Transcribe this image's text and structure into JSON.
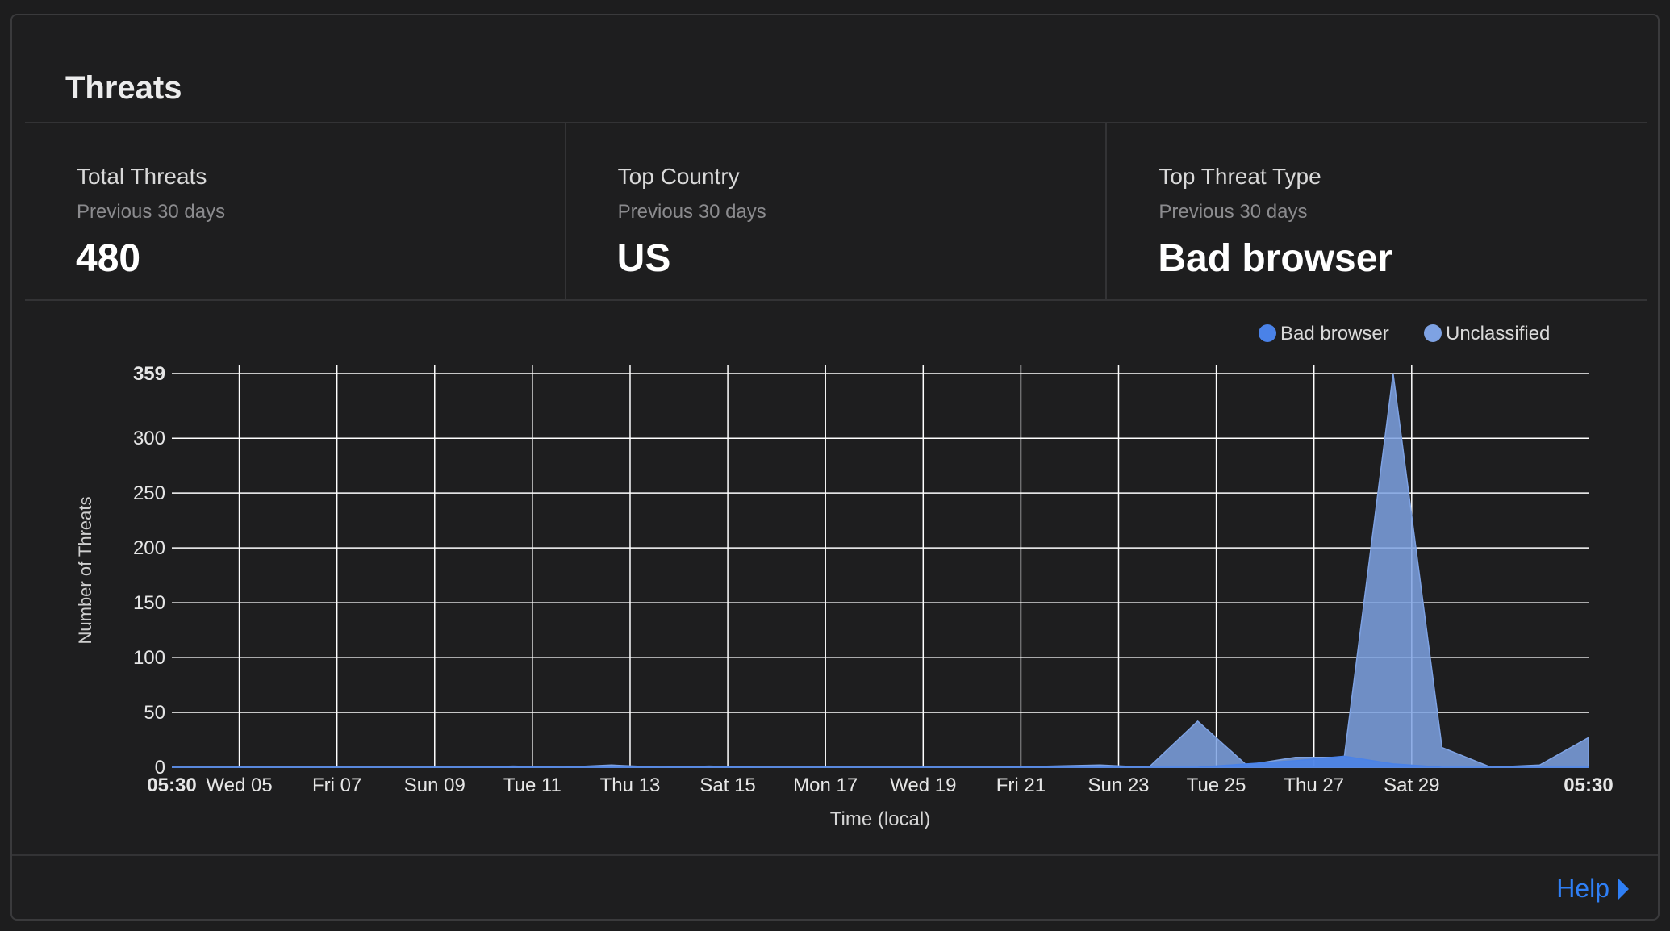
{
  "card": {
    "title": "Threats"
  },
  "stats": [
    {
      "label": "Total Threats",
      "sub": "Previous 30 days",
      "value": "480"
    },
    {
      "label": "Top Country",
      "sub": "Previous 30 days",
      "value": "US"
    },
    {
      "label": "Top Threat Type",
      "sub": "Previous 30 days",
      "value": "Bad browser"
    }
  ],
  "footer": {
    "help_label": "Help"
  },
  "chart_data": {
    "type": "area",
    "title": "",
    "xlabel": "Time (local)",
    "ylabel": "Number of Threats",
    "ylim": [
      0,
      359
    ],
    "yticks": [
      0,
      50,
      100,
      150,
      200,
      250,
      300,
      359
    ],
    "grid": true,
    "legend_position": "top-right",
    "x_tick_labels": [
      "05:30",
      "Wed 05",
      "Fri 07",
      "Sun 09",
      "Tue 11",
      "Thu 13",
      "Sat 15",
      "Mon 17",
      "Wed 19",
      "Fri 21",
      "Sun 23",
      "Tue 25",
      "Thu 27",
      "Sat 29",
      "05:30"
    ],
    "x_tick_days": [
      0,
      1.38,
      3.38,
      5.38,
      7.38,
      9.38,
      11.38,
      13.38,
      15.38,
      17.38,
      19.38,
      21.38,
      23.38,
      25.38,
      29
    ],
    "x_days": [
      0,
      1,
      2,
      3,
      4,
      5,
      6,
      7,
      8,
      9,
      10,
      11,
      12,
      13,
      14,
      15,
      16,
      17,
      18,
      19,
      20,
      21,
      22,
      23,
      24,
      25,
      26,
      27,
      28,
      29
    ],
    "series": [
      {
        "name": "Bad browser",
        "color": "#4a82e8",
        "values": [
          0,
          0,
          0,
          0,
          0,
          0,
          0,
          0,
          0,
          0,
          0,
          0,
          0,
          0,
          0,
          0,
          0,
          0,
          0,
          0,
          0,
          0,
          3,
          6,
          10,
          3,
          0,
          0,
          0,
          0
        ]
      },
      {
        "name": "Unclassified",
        "color": "#7ea2e3",
        "values": [
          0,
          0,
          0,
          0,
          0,
          0,
          0,
          1,
          0,
          2,
          0,
          1,
          0,
          0,
          0,
          0,
          0,
          0,
          1,
          2,
          0,
          42,
          2,
          9,
          9,
          359,
          18,
          0,
          2,
          27
        ]
      }
    ]
  }
}
